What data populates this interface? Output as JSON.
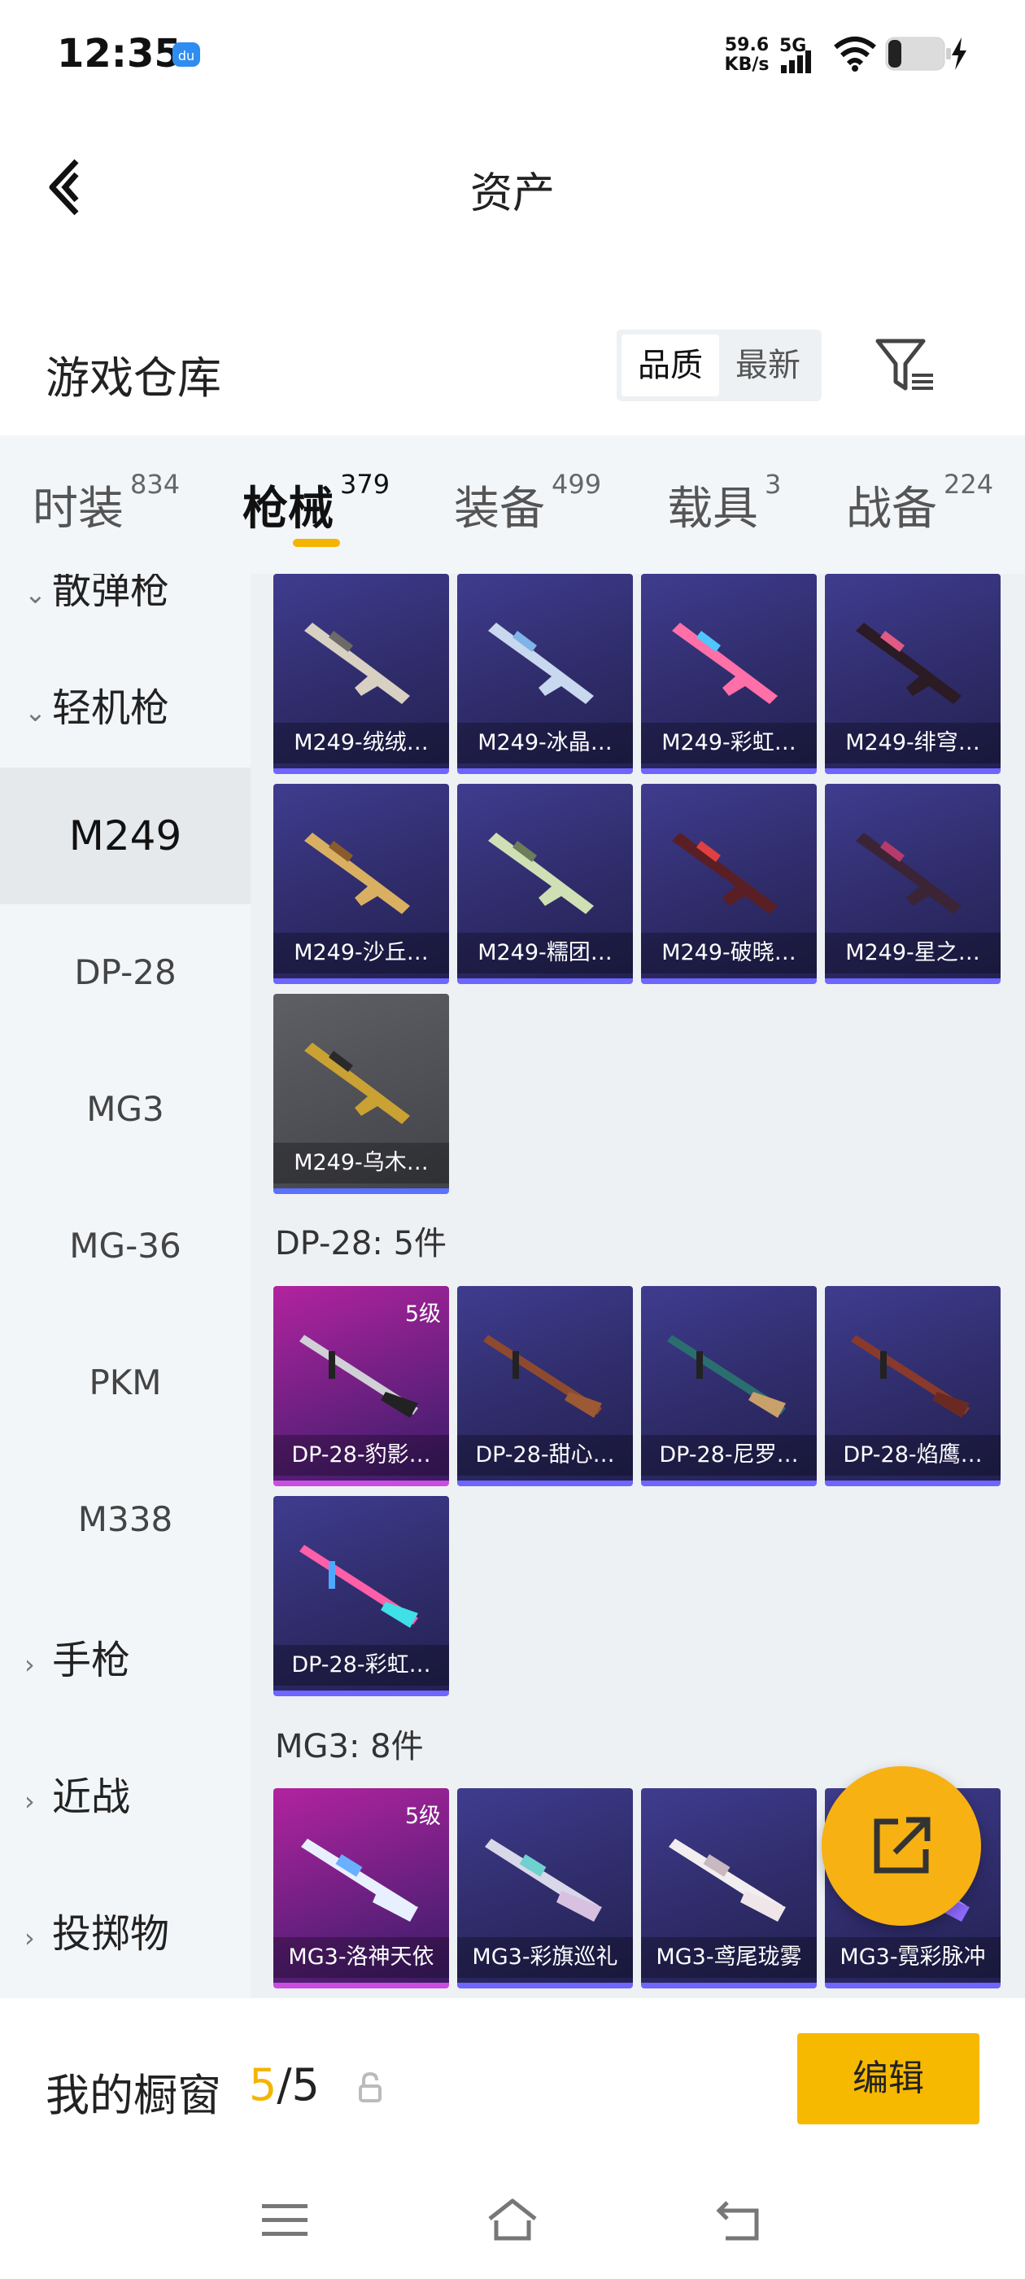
{
  "status": {
    "time": "12:35",
    "net_speed_value": "59.6",
    "net_speed_unit": "KB/s",
    "network": "5G"
  },
  "header": {
    "title": "资产"
  },
  "section": {
    "title": "游戏仓库",
    "sort_quality": "品质",
    "sort_latest": "最新"
  },
  "tabs": [
    {
      "label": "时装",
      "count": "834"
    },
    {
      "label": "枪械",
      "count": "379"
    },
    {
      "label": "装备",
      "count": "499"
    },
    {
      "label": "载具",
      "count": "3"
    },
    {
      "label": "战备",
      "count": "224"
    }
  ],
  "sidebar": {
    "partial_top": "散弹枪",
    "group_lmg": "轻机枪",
    "items": [
      "M249",
      "DP-28",
      "MG3",
      "MG-36",
      "PKM",
      "M338"
    ],
    "groups_below": [
      "手枪",
      "近战",
      "投掷物"
    ]
  },
  "grid": {
    "m249": [
      "M249-绒绒…",
      "M249-冰晶…",
      "M249-彩虹…",
      "M249-绯穹…",
      "M249-沙丘…",
      "M249-糯团…",
      "M249-破晓…",
      "M249-星之…",
      "M249-乌木…"
    ],
    "dp28_title": "DP-28: 5件",
    "dp28": [
      "DP-28-豹影…",
      "DP-28-甜心…",
      "DP-28-尼罗…",
      "DP-28-焰鹰…",
      "DP-28-彩虹…"
    ],
    "mg3_title": "MG3: 8件",
    "mg3": [
      "MG3-洛神天依",
      "MG3-彩旗巡礼",
      "MG3-鸢尾珑雾",
      "MG3-霓彩脉冲"
    ],
    "level_badge": "5级"
  },
  "showcase": {
    "label": "我的橱窗",
    "current": "5",
    "total": "/5",
    "edit": "编辑"
  },
  "colors": {
    "accent": "#f7b800",
    "card_blue": "#2f2c6a",
    "card_purple": "#b2239f"
  },
  "icons": [
    "back-icon",
    "filter-icon",
    "share-icon",
    "lock-icon",
    "menu-icon",
    "home-icon",
    "back-nav-icon"
  ]
}
